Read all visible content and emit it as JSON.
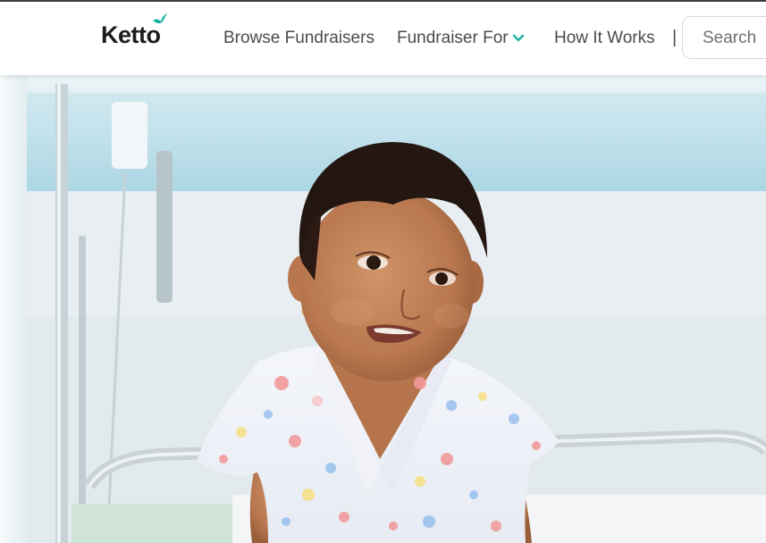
{
  "brand": {
    "name": "Ketto",
    "accent_color": "#1bb1a4",
    "logo_icon": "bird-icon"
  },
  "nav": {
    "browse_label": "Browse Fundraisers",
    "fundraiser_for_label": "Fundraiser For",
    "fundraiser_for_icon": "chevron-down-icon",
    "how_it_works_label": "How It Works",
    "divider": "|"
  },
  "search": {
    "placeholder": "Search",
    "value": ""
  },
  "hero": {
    "image_subject": "child in hospital gown sitting on hospital bed"
  }
}
